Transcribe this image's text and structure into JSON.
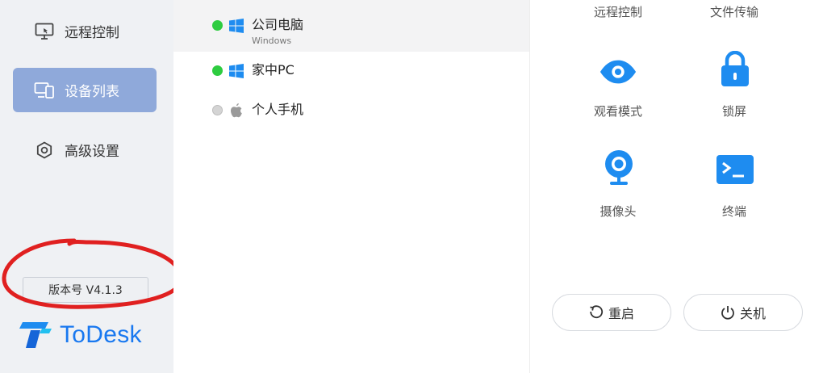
{
  "sidebar": {
    "items": [
      {
        "label": "远程控制",
        "icon": "monitor-icon",
        "active": false
      },
      {
        "label": "设备列表",
        "icon": "devices-icon",
        "active": true
      },
      {
        "label": "高级设置",
        "icon": "settings-icon",
        "active": false
      }
    ],
    "version": "版本号 V4.1.3",
    "logo_text": "ToDesk"
  },
  "devices": [
    {
      "name": "公司电脑",
      "os_label": "Windows",
      "os": "windows-icon",
      "status": "online"
    },
    {
      "name": "家中PC",
      "os_label": "",
      "os": "windows-icon",
      "status": "online"
    },
    {
      "name": "个人手机",
      "os_label": "",
      "os": "apple-icon",
      "status": "offline"
    }
  ],
  "actions": {
    "top_labels": [
      "远程控制",
      "文件传输"
    ],
    "grid": [
      {
        "label": "观看模式",
        "icon": "eye-icon"
      },
      {
        "label": "锁屏",
        "icon": "lock-icon"
      },
      {
        "label": "摄像头",
        "icon": "webcam-icon"
      },
      {
        "label": "终端",
        "icon": "terminal-icon"
      }
    ],
    "restart_label": "重启",
    "shutdown_label": "关机"
  },
  "colors": {
    "accent": "#1e8cf0",
    "active_nav": "#8fa9da",
    "online": "#2ecc40",
    "offline": "#cccccc",
    "annotation": "#e02020"
  }
}
